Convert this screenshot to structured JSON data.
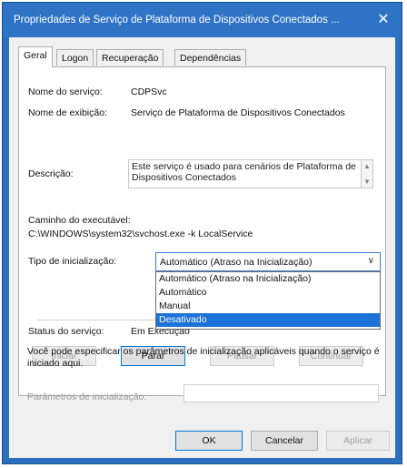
{
  "window": {
    "title": "Propriedades de Serviço de Plataforma de Dispositivos Conectados ...",
    "close_glyph": "✕"
  },
  "tabs": [
    {
      "label": "Geral"
    },
    {
      "label": "Logon"
    },
    {
      "label": "Recuperação"
    },
    {
      "label": "Dependências"
    }
  ],
  "general": {
    "service_name_label": "Nome do serviço:",
    "service_name_value": "CDPSvc",
    "display_name_label": "Nome de exibição:",
    "display_name_value": "Serviço de Plataforma de Dispositivos Conectados",
    "description_label": "Descrição:",
    "description_value": "Este serviço é usado para cenários de Plataforma de Dispositivos Conectados",
    "path_label": "Caminho do executável:",
    "path_value": "C:\\WINDOWS\\system32\\svchost.exe -k LocalService",
    "startup_type_label": "Tipo de inicialização:",
    "startup_type_value": "Automático (Atraso na Inicialização)",
    "startup_options": [
      "Automático (Atraso na Inicialização)",
      "Automático",
      "Manual",
      "Desativado"
    ],
    "highlighted_option": "Desativado",
    "status_label": "Status do serviço:",
    "status_value": "Em Execução"
  },
  "service_buttons": {
    "start": "Iniciar",
    "stop": "Parar",
    "pause": "Pausar",
    "resume": "Continuar"
  },
  "info_text": "Você pode especificar os parâmetros de inicialização aplicáveis quando o serviço é iniciado aqui.",
  "params_label": "Parâmetros de inicialização:",
  "dialog_buttons": {
    "ok": "OK",
    "cancel": "Cancelar",
    "apply": "Aplicar"
  },
  "colors": {
    "titlebar": "#2f73c6",
    "selection": "#1c72d6"
  }
}
